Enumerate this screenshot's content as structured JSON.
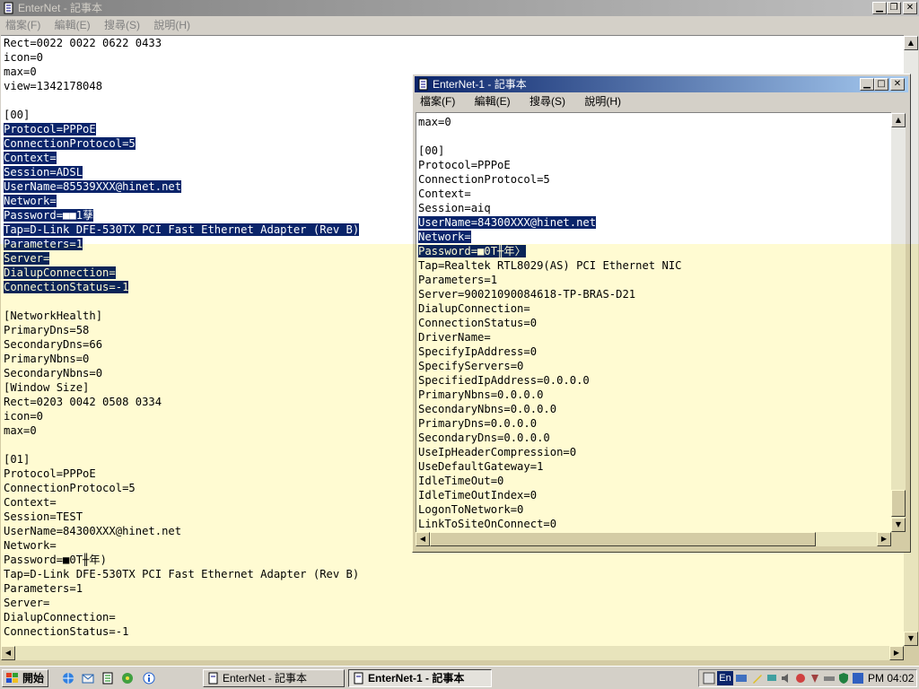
{
  "window1": {
    "title": "EnterNet - 記事本",
    "menu": [
      "檔案(F)",
      "編輯(E)",
      "搜尋(S)",
      "說明(H)"
    ],
    "lines": [
      {
        "t": "Rect=0022 0022 0622 0433",
        "s": false
      },
      {
        "t": "icon=0",
        "s": false
      },
      {
        "t": "max=0",
        "s": false
      },
      {
        "t": "view=1342178048",
        "s": false
      },
      {
        "t": "",
        "s": false
      },
      {
        "t": "[00]",
        "s": false
      },
      {
        "t": "Protocol=PPPoE",
        "s": true
      },
      {
        "t": "ConnectionProtocol=5",
        "s": true
      },
      {
        "t": "Context=",
        "s": true
      },
      {
        "t": "Session=ADSL",
        "s": true
      },
      {
        "t": "UserName=85539XXX@hinet.net",
        "s": true
      },
      {
        "t": "Network=",
        "s": true
      },
      {
        "t": "Password=■■1孶",
        "s": true
      },
      {
        "t": "Tap=D-Link DFE-530TX PCI Fast Ethernet Adapter (Rev B)",
        "s": true
      },
      {
        "t": "Parameters=1",
        "s": true
      },
      {
        "t": "Server=",
        "s": true
      },
      {
        "t": "DialupConnection=",
        "s": true
      },
      {
        "t": "ConnectionStatus=-1",
        "s": true
      },
      {
        "t": "",
        "s": false
      },
      {
        "t": "[NetworkHealth]",
        "s": false
      },
      {
        "t": "PrimaryDns=58",
        "s": false
      },
      {
        "t": "SecondaryDns=66",
        "s": false
      },
      {
        "t": "PrimaryNbns=0",
        "s": false
      },
      {
        "t": "SecondaryNbns=0",
        "s": false
      },
      {
        "t": "[Window Size]",
        "s": false
      },
      {
        "t": "Rect=0203 0042 0508 0334",
        "s": false
      },
      {
        "t": "icon=0",
        "s": false
      },
      {
        "t": "max=0",
        "s": false
      },
      {
        "t": "",
        "s": false
      },
      {
        "t": "[01]",
        "s": false
      },
      {
        "t": "Protocol=PPPoE",
        "s": false
      },
      {
        "t": "ConnectionProtocol=5",
        "s": false
      },
      {
        "t": "Context=",
        "s": false
      },
      {
        "t": "Session=TEST",
        "s": false
      },
      {
        "t": "UserName=84300XXX@hinet.net",
        "s": false
      },
      {
        "t": "Network=",
        "s": false
      },
      {
        "t": "Password=■0T╫年)",
        "s": false
      },
      {
        "t": "Tap=D-Link DFE-530TX PCI Fast Ethernet Adapter (Rev B)",
        "s": false
      },
      {
        "t": "Parameters=1",
        "s": false
      },
      {
        "t": "Server=",
        "s": false
      },
      {
        "t": "DialupConnection=",
        "s": false
      },
      {
        "t": "ConnectionStatus=-1",
        "s": false
      }
    ]
  },
  "window2": {
    "title": "EnterNet-1 - 記事本",
    "menu": [
      "檔案(F)",
      "編輯(E)",
      "搜尋(S)",
      "說明(H)"
    ],
    "lines": [
      {
        "t": "max=0",
        "s": false
      },
      {
        "t": "",
        "s": false
      },
      {
        "t": "[00]",
        "s": false
      },
      {
        "t": "Protocol=PPPoE",
        "s": false
      },
      {
        "t": "ConnectionProtocol=5",
        "s": false
      },
      {
        "t": "Context=",
        "s": false
      },
      {
        "t": "Session=aiq",
        "s": false
      },
      {
        "t": "UserName=84300XXX@hinet.net",
        "s": true
      },
      {
        "t": "Network=",
        "s": true
      },
      {
        "t": "Password=■0T╫年〉",
        "s": true
      },
      {
        "t": "Tap=Realtek RTL8029(AS) PCI Ethernet NIC",
        "s": false
      },
      {
        "t": "Parameters=1",
        "s": false
      },
      {
        "t": "Server=90021090084618-TP-BRAS-D21",
        "s": false
      },
      {
        "t": "DialupConnection=",
        "s": false
      },
      {
        "t": "ConnectionStatus=0",
        "s": false
      },
      {
        "t": "DriverName=",
        "s": false
      },
      {
        "t": "SpecifyIpAddress=0",
        "s": false
      },
      {
        "t": "SpecifyServers=0",
        "s": false
      },
      {
        "t": "SpecifiedIpAddress=0.0.0.0",
        "s": false
      },
      {
        "t": "PrimaryNbns=0.0.0.0",
        "s": false
      },
      {
        "t": "SecondaryNbns=0.0.0.0",
        "s": false
      },
      {
        "t": "PrimaryDns=0.0.0.0",
        "s": false
      },
      {
        "t": "SecondaryDns=0.0.0.0",
        "s": false
      },
      {
        "t": "UseIpHeaderCompression=0",
        "s": false
      },
      {
        "t": "UseDefaultGateway=1",
        "s": false
      },
      {
        "t": "IdleTimeOut=0",
        "s": false
      },
      {
        "t": "IdleTimeOutIndex=0",
        "s": false
      },
      {
        "t": "LogonToNetwork=0",
        "s": false
      },
      {
        "t": "LinkToSiteOnConnect=0",
        "s": false
      }
    ]
  },
  "taskbar": {
    "start_label": "開始",
    "tasks": [
      "EnterNet - 記事本",
      "EnterNet-1 - 記事本"
    ],
    "tray_en": "En",
    "clock": "PM 04:02"
  },
  "colors": {
    "selection": "#0a246a",
    "title_inactive": "#808080",
    "title_active_start": "#0a246a",
    "title_active_end": "#a6caf0",
    "overlay_tint": "#fffbd2"
  }
}
